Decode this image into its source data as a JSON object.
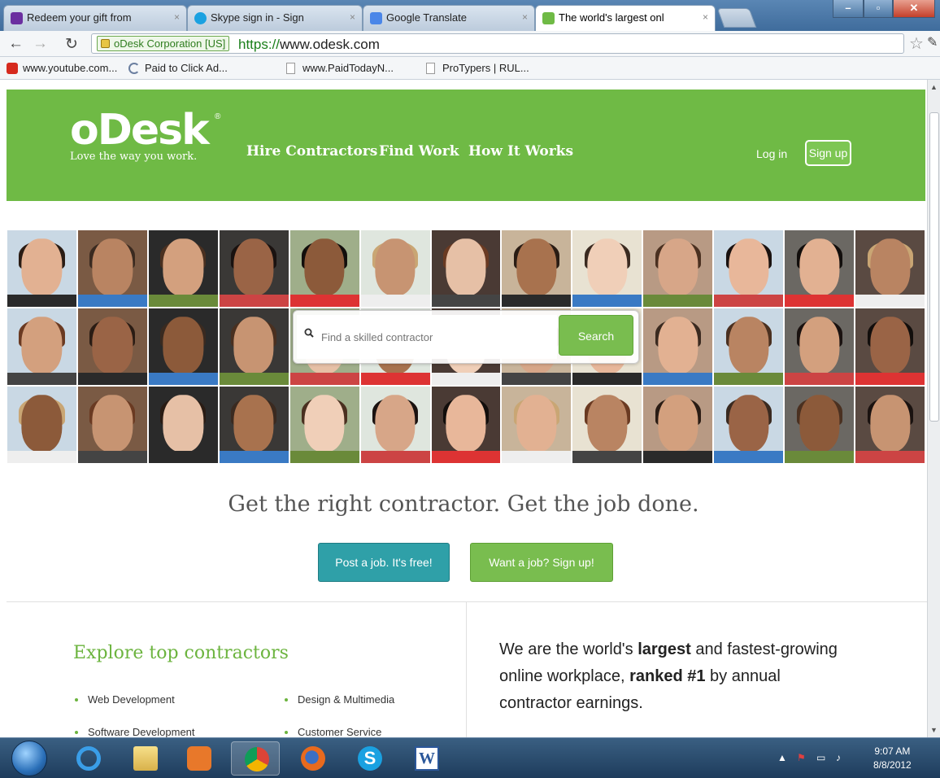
{
  "browser": {
    "tabs": [
      {
        "label": "Redeem your gift from",
        "close": "×",
        "icon": "yahoo-icon"
      },
      {
        "label": "Skype sign in - Sign",
        "close": "×",
        "icon": "skype-icon"
      },
      {
        "label": "Google Translate",
        "close": "×",
        "icon": "translate-icon"
      },
      {
        "label": "The world's largest onl",
        "close": "×",
        "icon": "odesk-favicon"
      }
    ],
    "security_chip": "oDesk Corporation [US]",
    "url_scheme": "https://",
    "url_host": "www.odesk.com",
    "bookmarks": [
      {
        "label": "www.youtube.com...",
        "icon": "youtube-icon"
      },
      {
        "label": "Paid to Click Ad...",
        "icon": "moon-icon"
      },
      {
        "label": "www.PaidTodayN...",
        "icon": "page-icon"
      },
      {
        "label": "ProTypers | RUL...",
        "icon": "page-icon"
      }
    ]
  },
  "header": {
    "logo": "oDesk",
    "logo_mark": "®",
    "tagline": "Love the way you work.",
    "nav": [
      "Hire Contractors",
      "Find Work",
      "How It Works"
    ],
    "login": "Log in",
    "signup": "Sign up"
  },
  "search": {
    "placeholder": "Find a skilled contractor",
    "button": "Search"
  },
  "headline": "Get the right contractor. Get the job done.",
  "cta": {
    "post_job": "Post a job. It's free!",
    "want_job": "Want a job? Sign up!"
  },
  "explore": {
    "title": "Explore top contractors",
    "categories": [
      "Web Development",
      "Design & Multimedia",
      "Software Development",
      "Customer Service"
    ]
  },
  "about": {
    "part1": "We are the world's ",
    "bold1": "largest",
    "part2": " and fastest-growing online workplace, ",
    "bold2": "ranked #1",
    "part3": " by annual contractor earnings."
  },
  "taskbar": {
    "apps": [
      "internet-explorer-icon",
      "file-explorer-icon",
      "media-player-icon",
      "chrome-icon",
      "firefox-icon",
      "skype-icon",
      "word-icon"
    ],
    "active": "chrome-icon",
    "time": "9:07 AM",
    "date": "8/8/2012"
  },
  "colors": {
    "brand_green": "#6fba45",
    "teal": "#2fa0a8"
  }
}
